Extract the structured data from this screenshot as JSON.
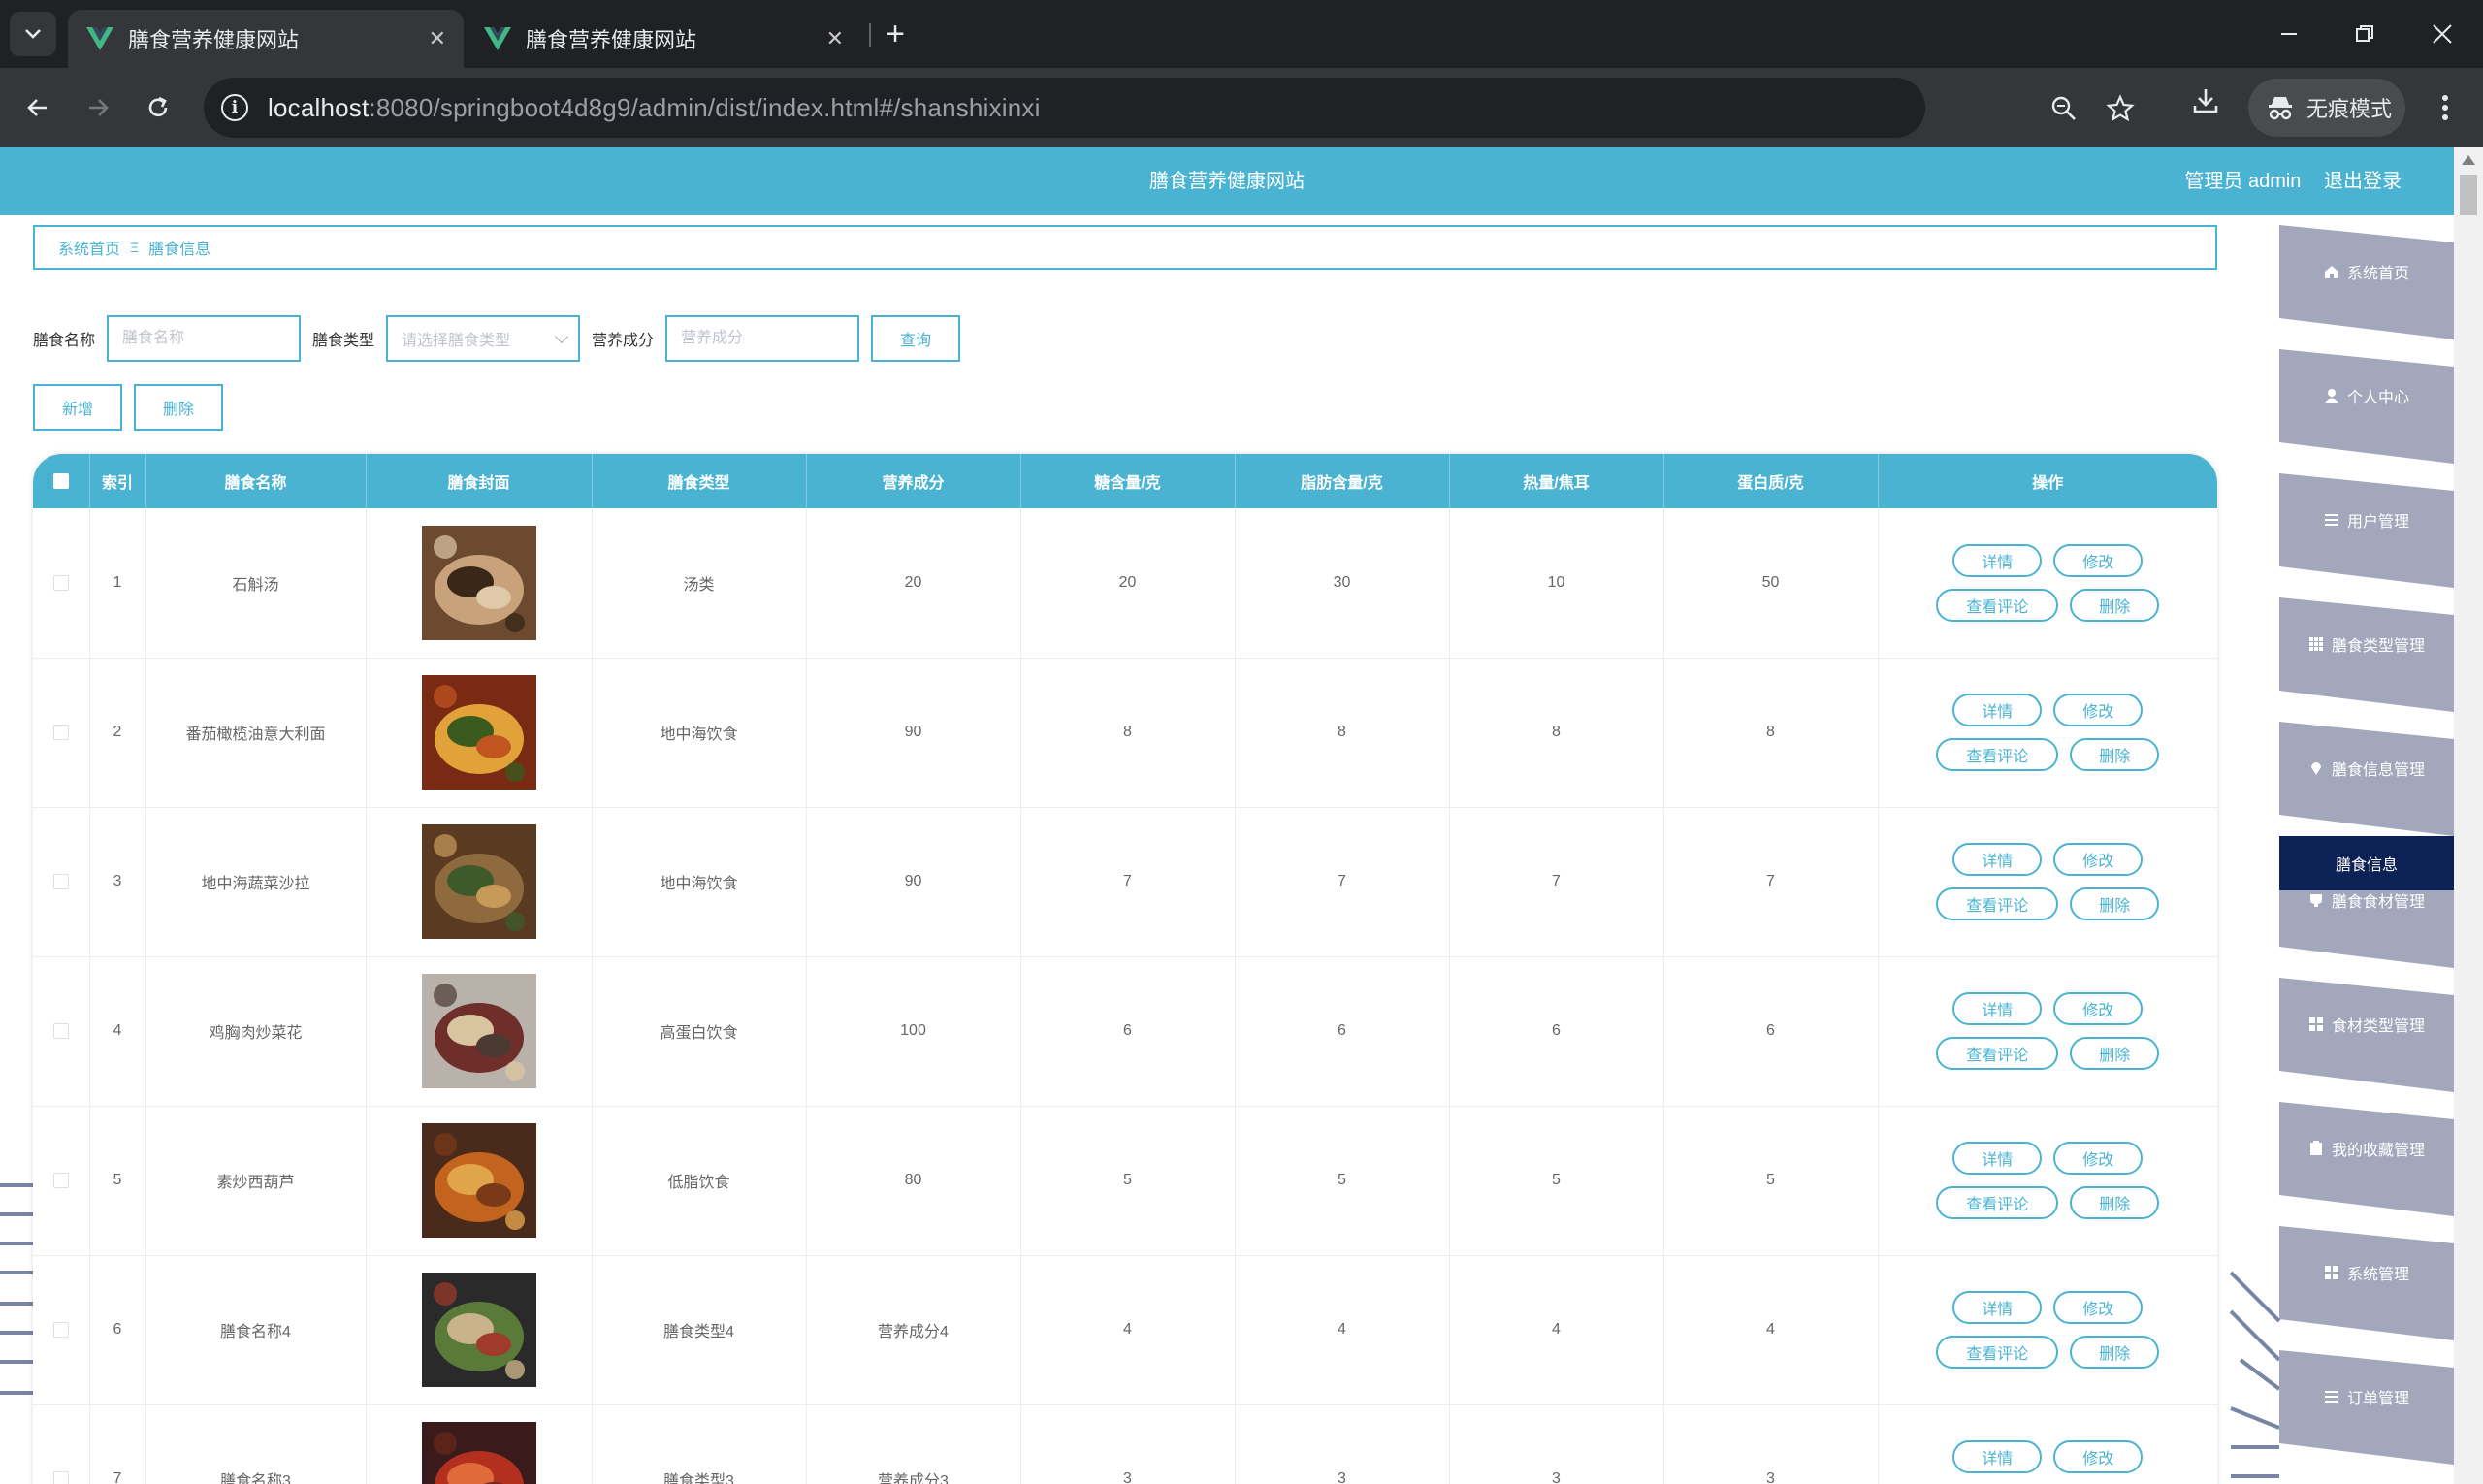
{
  "browser": {
    "tabs": [
      {
        "title": "膳食营养健康网站",
        "active": true
      },
      {
        "title": "膳食营养健康网站",
        "active": false
      }
    ],
    "url_host": "localhost",
    "url_rest": ":8080/springboot4d8g9/admin/dist/index.html#/shanshixinxi",
    "incognito_label": "无痕模式"
  },
  "header": {
    "site_title": "膳食营养健康网站",
    "user_label": "管理员 admin",
    "logout_label": "退出登录"
  },
  "breadcrumb": {
    "home": "系统首页",
    "separator": "Ξ",
    "current": "膳食信息"
  },
  "filters": {
    "name_label": "膳食名称",
    "name_placeholder": "膳食名称",
    "type_label": "膳食类型",
    "type_placeholder": "请选择膳食类型",
    "nutrition_label": "营养成分",
    "nutrition_placeholder": "营养成分",
    "search_button": "查询"
  },
  "actions": {
    "add_button": "新增",
    "delete_button": "删除"
  },
  "table": {
    "columns": [
      "",
      "索引",
      "膳食名称",
      "膳食封面",
      "膳食类型",
      "营养成分",
      "糖含量/克",
      "脂肪含量/克",
      "热量/焦耳",
      "蛋白质/克",
      "操作"
    ],
    "row_buttons": {
      "detail": "详情",
      "edit": "修改",
      "comments": "查看评论",
      "delete": "删除"
    },
    "rows": [
      {
        "index": "1",
        "name": "石斛汤",
        "type": "汤类",
        "nutrition": "20",
        "sugar": "20",
        "fat": "30",
        "heat": "10",
        "protein": "50",
        "cover": "food-photo-1"
      },
      {
        "index": "2",
        "name": "番茄橄榄油意大利面",
        "type": "地中海饮食",
        "nutrition": "90",
        "sugar": "8",
        "fat": "8",
        "heat": "8",
        "protein": "8",
        "cover": "food-photo-2"
      },
      {
        "index": "3",
        "name": "地中海蔬菜沙拉",
        "type": "地中海饮食",
        "nutrition": "90",
        "sugar": "7",
        "fat": "7",
        "heat": "7",
        "protein": "7",
        "cover": "food-photo-3"
      },
      {
        "index": "4",
        "name": "鸡胸肉炒菜花",
        "type": "高蛋白饮食",
        "nutrition": "100",
        "sugar": "6",
        "fat": "6",
        "heat": "6",
        "protein": "6",
        "cover": "food-photo-4"
      },
      {
        "index": "5",
        "name": "素炒西葫芦",
        "type": "低脂饮食",
        "nutrition": "80",
        "sugar": "5",
        "fat": "5",
        "heat": "5",
        "protein": "5",
        "cover": "food-photo-5"
      },
      {
        "index": "6",
        "name": "膳食名称4",
        "type": "膳食类型4",
        "nutrition": "营养成分4",
        "sugar": "4",
        "fat": "4",
        "heat": "4",
        "protein": "4",
        "cover": "food-photo-6"
      },
      {
        "index": "7",
        "name": "膳食名称3",
        "type": "膳食类型3",
        "nutrition": "营养成分3",
        "sugar": "3",
        "fat": "3",
        "heat": "3",
        "protein": "3",
        "cover": "food-photo-7"
      }
    ]
  },
  "sidemenu": {
    "items": [
      {
        "label": "系统首页",
        "icon": "home-icon"
      },
      {
        "label": "个人中心",
        "icon": "user-icon"
      },
      {
        "label": "用户管理",
        "icon": "list-icon"
      },
      {
        "label": "膳食类型管理",
        "icon": "grid-icon"
      },
      {
        "label": "膳食信息管理",
        "icon": "pin-icon"
      },
      {
        "label": "膳食食材管理",
        "icon": "cup-icon"
      },
      {
        "label": "食材类型管理",
        "icon": "apps-icon"
      },
      {
        "label": "我的收藏管理",
        "icon": "clipboard-icon"
      },
      {
        "label": "系统管理",
        "icon": "apps-icon"
      },
      {
        "label": "订单管理",
        "icon": "list-icon"
      }
    ],
    "active_label": "膳食信息"
  },
  "colors": {
    "primary": "#4ab3d2",
    "menu_item": "#a3a7bc",
    "menu_active": "#0c2257",
    "chrome_dark": "#202124",
    "chrome_mid": "#35363a"
  }
}
